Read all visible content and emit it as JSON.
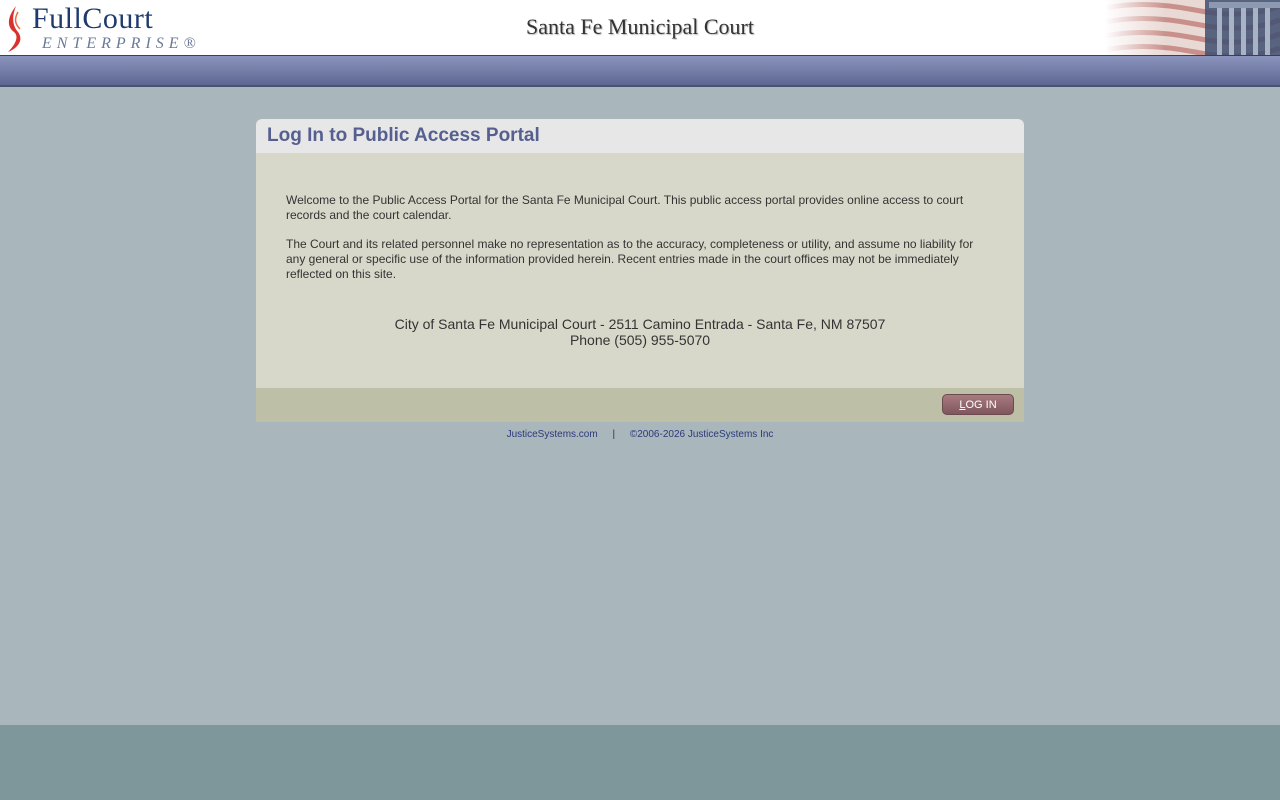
{
  "header": {
    "brand": "FullCourt",
    "brand_sub": "ENTERPRISE®",
    "court_title": "Santa Fe Municipal Court"
  },
  "panel": {
    "title": "Log In to Public Access Portal",
    "paragraph1": "Welcome to the Public Access Portal for the Santa Fe Municipal Court. This public access portal provides online access to court records and the court calendar.",
    "paragraph2": "The Court and its related personnel make no representation as to the accuracy, completeness or utility, and assume no liability for any general or specific use of the information provided herein. Recent entries made in the court offices may not be immediately reflected on this site.",
    "address_line": "City of Santa Fe Municipal Court - 2511 Camino Entrada - Santa Fe, NM 87507",
    "phone_line": "Phone (505) 955-5070",
    "login_button": {
      "underlined_char": "L",
      "rest": "OG IN"
    }
  },
  "footer": {
    "link": "JusticeSystems.com",
    "separator": "|",
    "copyright": "©2006-2026 JusticeSystems Inc"
  },
  "colors": {
    "page_bg": "#a9b6bb",
    "navbar": "#6f79a3",
    "panel_title": "#566090",
    "panel_body": "#d8d8ca",
    "panel_footer": "#bdbfa6",
    "button": "#8f666b",
    "footer_band": "#7e979b"
  }
}
